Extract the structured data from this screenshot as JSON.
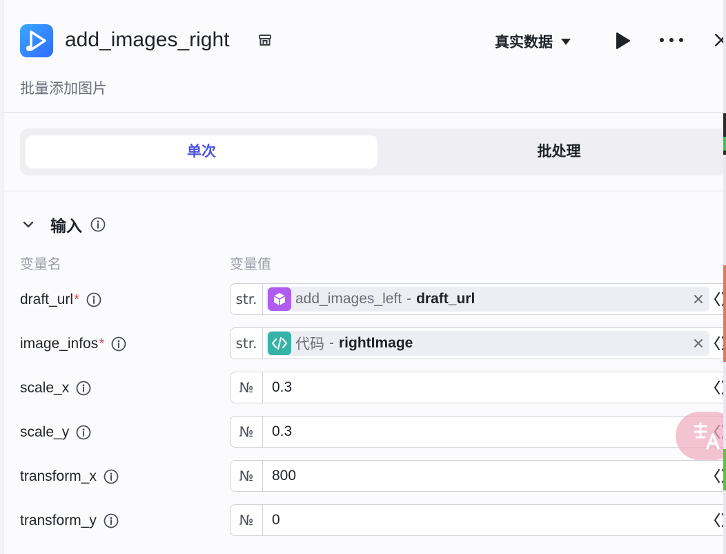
{
  "header": {
    "app_icon": "play-node-icon",
    "title": "add_images_right",
    "store_icon": "store-icon",
    "mode_select": "真实数据",
    "subtitle": "批量添加图片",
    "run_icon": "play-icon",
    "more_icon": "more-horizontal-icon",
    "close_icon": "close-icon"
  },
  "tabs": [
    {
      "label": "单次",
      "active": true
    },
    {
      "label": "批处理",
      "active": false
    }
  ],
  "section": {
    "title": "输入",
    "col_name": "变量名",
    "col_value": "变量值"
  },
  "rows": [
    {
      "name": "draft_url",
      "required": "*",
      "type": "str.",
      "ref_node": "add_images_left",
      "ref_sep": "-",
      "ref_var": "draft_url",
      "ref_icon": "cube-icon",
      "ref_icon_color": "#b15cf0"
    },
    {
      "name": "image_infos",
      "required": "*",
      "type": "str.",
      "ref_node": "代码",
      "ref_sep": "-",
      "ref_var": "rightImage",
      "ref_icon": "code-icon",
      "ref_icon_color": "#36b2a6"
    },
    {
      "name": "scale_x",
      "type": "№",
      "value": "0.3"
    },
    {
      "name": "scale_y",
      "type": "№",
      "value": "0.3"
    },
    {
      "name": "transform_x",
      "type": "№",
      "value": "800"
    },
    {
      "name": "transform_y",
      "type": "№",
      "value": "0"
    }
  ],
  "colors": {
    "accent": "#4d53e8",
    "required": "#e34d4d",
    "app_icon": "#3a8bff"
  },
  "fab_icon": "translate-icon"
}
